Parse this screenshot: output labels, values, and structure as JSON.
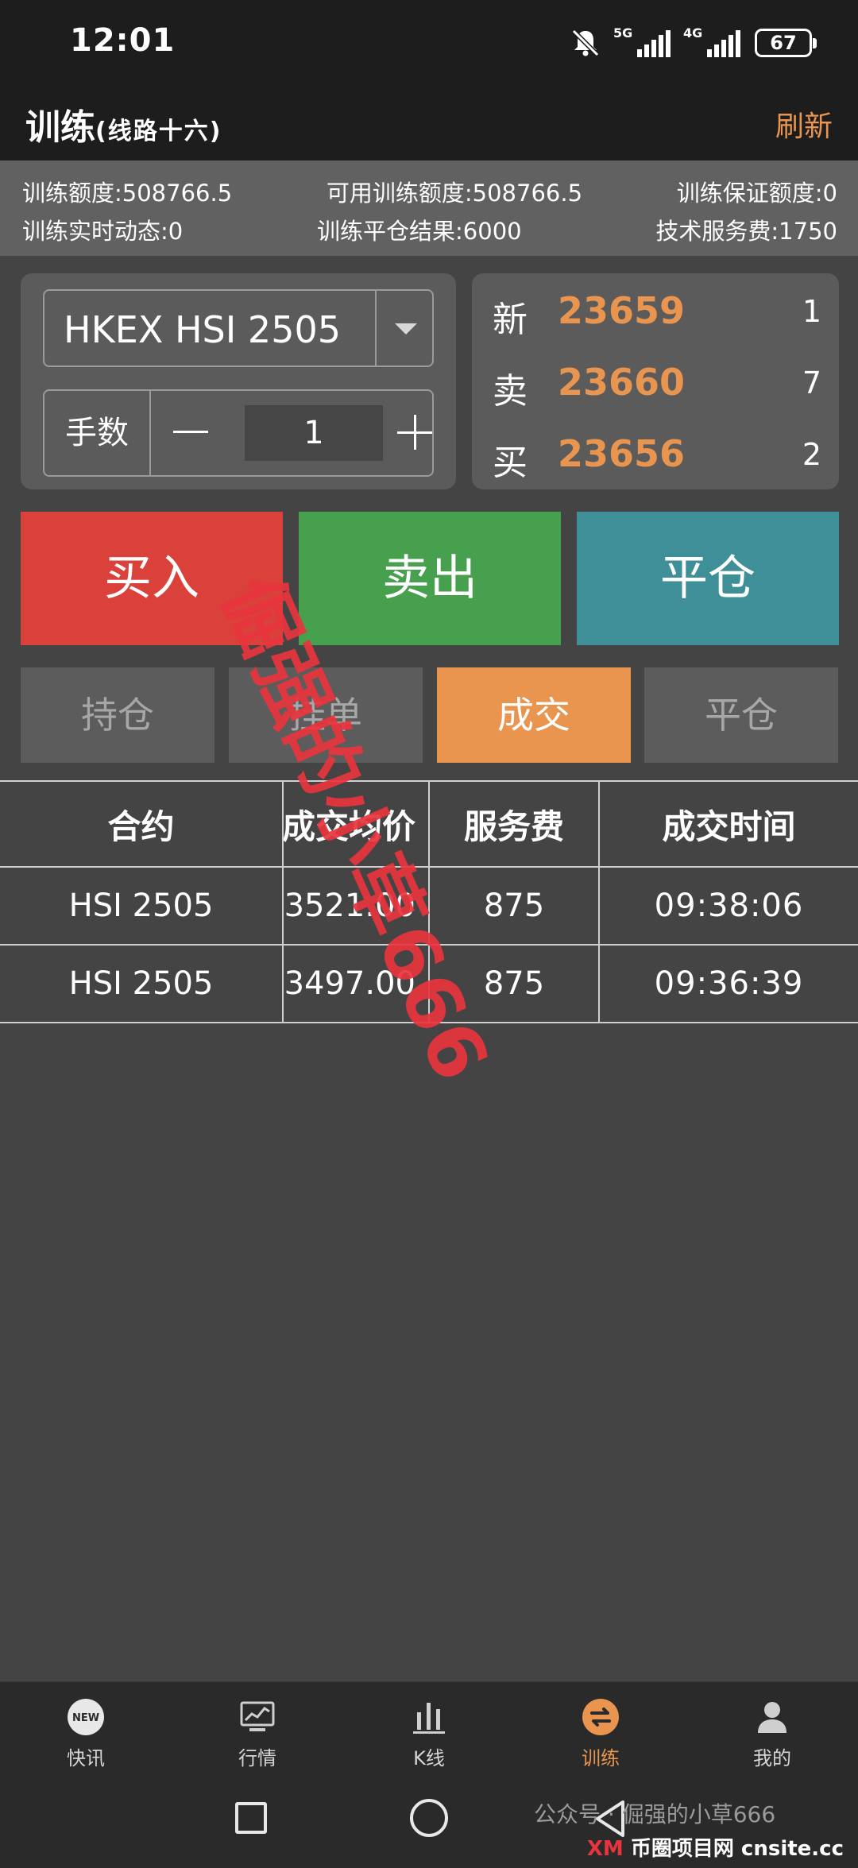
{
  "status_bar": {
    "time": "12:01",
    "net1": "5G",
    "net2": "4G",
    "battery": "67"
  },
  "header": {
    "title": "训练",
    "subtitle": "(线路十六)",
    "refresh_label": "刷新"
  },
  "account": {
    "row1": [
      "训练额度:508766.5",
      "可用训练额度:508766.5",
      "训练保证额度:0"
    ],
    "row2": [
      "训练实时动态:0",
      "训练平仓结果:6000",
      "技术服务费:1750"
    ]
  },
  "order": {
    "contract": "HKEX HSI 2505",
    "qty_label": "手数",
    "qty_value": "1"
  },
  "quotes": [
    {
      "label": "新",
      "price": "23659",
      "qty": "1"
    },
    {
      "label": "卖",
      "price": "23660",
      "qty": "7"
    },
    {
      "label": "买",
      "price": "23656",
      "qty": "2"
    }
  ],
  "actions": {
    "buy": "买入",
    "sell": "卖出",
    "close": "平仓"
  },
  "tabs": [
    {
      "label": "持仓",
      "active": false
    },
    {
      "label": "挂单",
      "active": false
    },
    {
      "label": "成交",
      "active": true
    },
    {
      "label": "平仓",
      "active": false
    }
  ],
  "table": {
    "headers": [
      "合约",
      "成交均价",
      "服务费",
      "成交时间"
    ],
    "rows": [
      [
        "HSI 2505",
        "3521.00",
        "875",
        "09:38:06"
      ],
      [
        "HSI 2505",
        "3497.00",
        "875",
        "09:36:39"
      ]
    ]
  },
  "watermark": "倔强的小草666",
  "bottom_nav": [
    {
      "label": "快讯",
      "icon": "news-icon",
      "badge": "NEW"
    },
    {
      "label": "行情",
      "icon": "market-chart-icon"
    },
    {
      "label": "K线",
      "icon": "kline-bars-icon"
    },
    {
      "label": "训练",
      "icon": "training-swap-icon"
    },
    {
      "label": "我的",
      "icon": "profile-icon"
    }
  ],
  "footer_credit": "公众号 · 倔强的小草666",
  "footer_brand": {
    "a": "XM",
    "b": "币圈项目网",
    "c": "cnsite.cc"
  },
  "colors": {
    "accent": "#e9954f",
    "buy": "#d9413a",
    "sell": "#47a04d",
    "close": "#3f8f99"
  }
}
